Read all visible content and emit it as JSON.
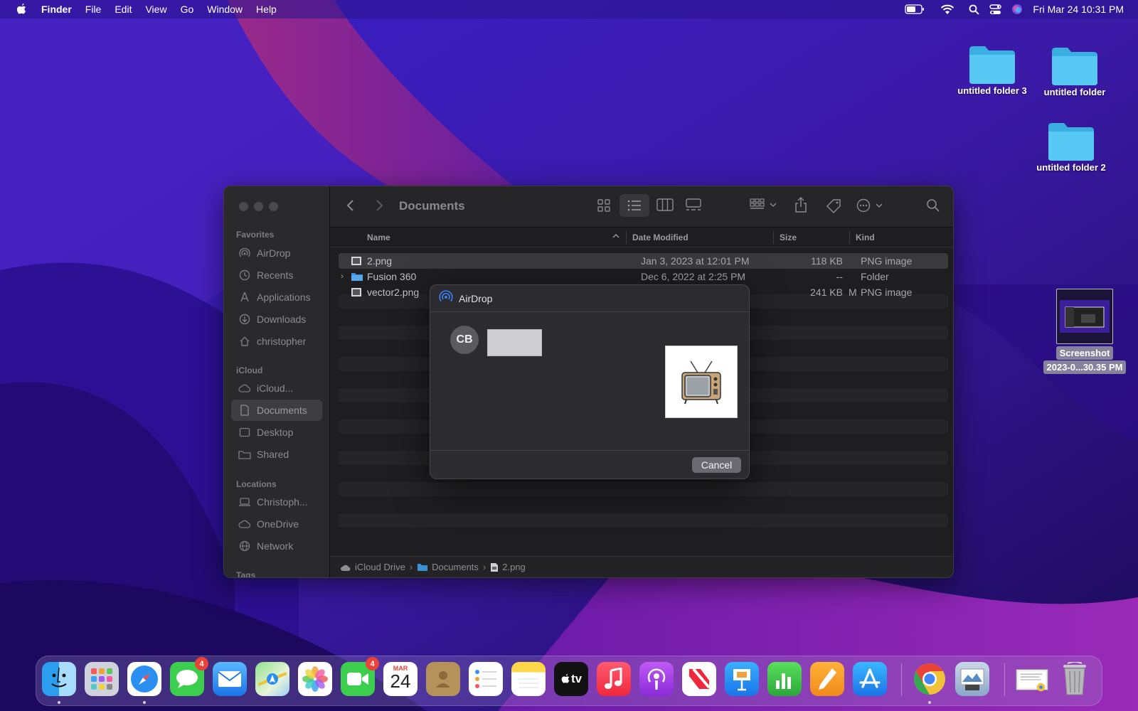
{
  "menubar": {
    "app_name": "Finder",
    "menus": [
      "File",
      "Edit",
      "View",
      "Go",
      "Window",
      "Help"
    ],
    "clock": "Fri Mar 24  10:31 PM"
  },
  "desktop": {
    "folders": [
      "untitled folder 3",
      "untitled folder",
      "untitled folder 2"
    ],
    "screenshot_label_line1": "Screenshot",
    "screenshot_label_line2": "2023-0...30.35 PM"
  },
  "finder": {
    "title": "Documents",
    "sidebar": {
      "favorites_header": "Favorites",
      "favorites": [
        "AirDrop",
        "Recents",
        "Applications",
        "Downloads",
        "christopher"
      ],
      "icloud_header": "iCloud",
      "icloud": [
        "iCloud...",
        "Documents",
        "Desktop",
        "Shared"
      ],
      "locations_header": "Locations",
      "locations": [
        "Christoph...",
        "OneDrive",
        "Network"
      ],
      "tags_header": "Tags"
    },
    "columns": {
      "name": "Name",
      "date": "Date Modified",
      "size": "Size",
      "kind": "Kind"
    },
    "files": [
      {
        "name": "2.png",
        "date": "Jan 3, 2023 at 12:01 PM",
        "size": "118 KB",
        "kind": "PNG image"
      },
      {
        "name": "Fusion 360",
        "date": "Dec 6, 2022 at 2:25 PM",
        "size": "--",
        "kind": "Folder"
      },
      {
        "name": "vector2.png",
        "date": "M",
        "size": "241 KB",
        "kind": "PNG image"
      }
    ],
    "pathbar": [
      "iCloud Drive",
      "Documents",
      "2.png"
    ]
  },
  "airdrop": {
    "title": "AirDrop",
    "recipient_initials": "CB",
    "cancel_label": "Cancel"
  },
  "dock": {
    "apps": [
      "Finder",
      "Launchpad",
      "Safari",
      "Messages",
      "Mail",
      "Maps",
      "Photos",
      "FaceTime",
      "Calendar",
      "Contacts",
      "Reminders",
      "Notes",
      "TV",
      "Music",
      "Podcasts",
      "News",
      "Keynote",
      "Numbers",
      "Pages",
      "App Store",
      "Chrome",
      "Preview",
      "Screenshot Stack",
      "Trash"
    ],
    "messages_badge": "4",
    "facetime_badge": "4",
    "calendar_month": "MAR",
    "calendar_day": "24",
    "tv_label": "tv"
  },
  "colors": {
    "accent": "#3b82f6",
    "folder": "#4cc3f2",
    "badge": "#e94238"
  }
}
